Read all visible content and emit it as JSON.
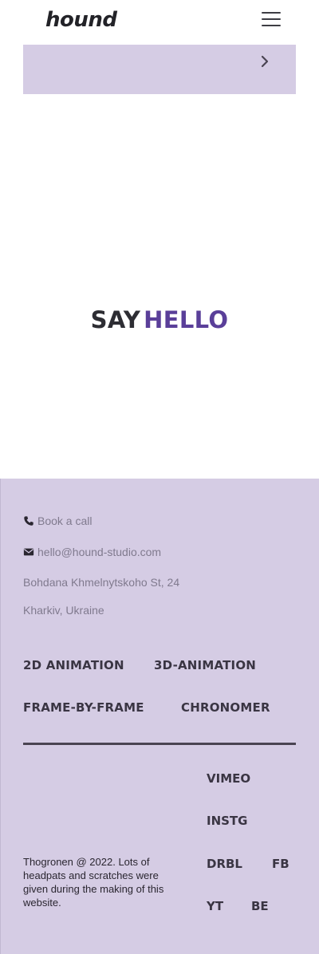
{
  "header": {
    "logo": "hound",
    "menu_icon": "hamburger-menu-icon"
  },
  "banner": {
    "icon": "chevron-right-icon"
  },
  "hero": {
    "say": "SAY",
    "hello": "HELLO",
    "accent_color": "#5a3f99"
  },
  "footer": {
    "background_color": "#d5cce4",
    "contacts": {
      "call": "Book a call",
      "email": "hello@hound-studio.com",
      "address_line1": "Bohdana Khmelnytskoho St, 24",
      "address_line2": "Kharkiv, Ukraine"
    },
    "services": [
      "2D ANIMATION",
      "3D-ANIMATION",
      "FRAME-BY-FRAME",
      "CHRONOMER"
    ],
    "social": {
      "vimeo": "VIMEO",
      "instagram": "INSTG",
      "dribbble": "DRBL",
      "facebook": "FB",
      "youtube": "YT",
      "behance": "BE"
    },
    "copyright": "Thogronen @ 2022. Lots of headpats and scratches were given during the making of this website."
  }
}
